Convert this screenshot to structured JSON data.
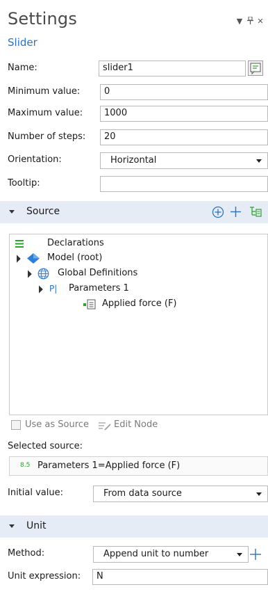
{
  "header": {
    "title": "Settings",
    "subtitle": "Slider"
  },
  "form": {
    "name_label": "Name:",
    "name_value": "slider1",
    "min_label": "Minimum value:",
    "min_value": "0",
    "max_label": "Maximum value:",
    "max_value": "1000",
    "steps_label": "Number of steps:",
    "steps_value": "20",
    "orientation_label": "Orientation:",
    "orientation_value": "Horizontal",
    "tooltip_label": "Tooltip:",
    "tooltip_value": ""
  },
  "source": {
    "title": "Source",
    "tree": [
      {
        "label": "Declarations"
      },
      {
        "label": "Model (root)"
      },
      {
        "label": "Global Definitions"
      },
      {
        "label": "Parameters 1",
        "prefix": "P|"
      },
      {
        "label": "Applied force (F)"
      }
    ],
    "use_as_source": "Use as Source",
    "edit_node": "Edit Node",
    "selected_label": "Selected source:",
    "selected_value": "Parameters 1=Applied force (F)",
    "selected_prefix": "8.5",
    "initial_label": "Initial value:",
    "initial_value": "From data source"
  },
  "unit": {
    "title": "Unit",
    "method_label": "Method:",
    "method_value": "Append unit to number",
    "expr_label": "Unit expression:",
    "expr_value": "N"
  },
  "colors": {
    "accent": "#2e72b8",
    "section_bg": "#e6ecf5",
    "tree_icon_green": "#2aa52a",
    "model_blue": "#2f7fd6"
  }
}
